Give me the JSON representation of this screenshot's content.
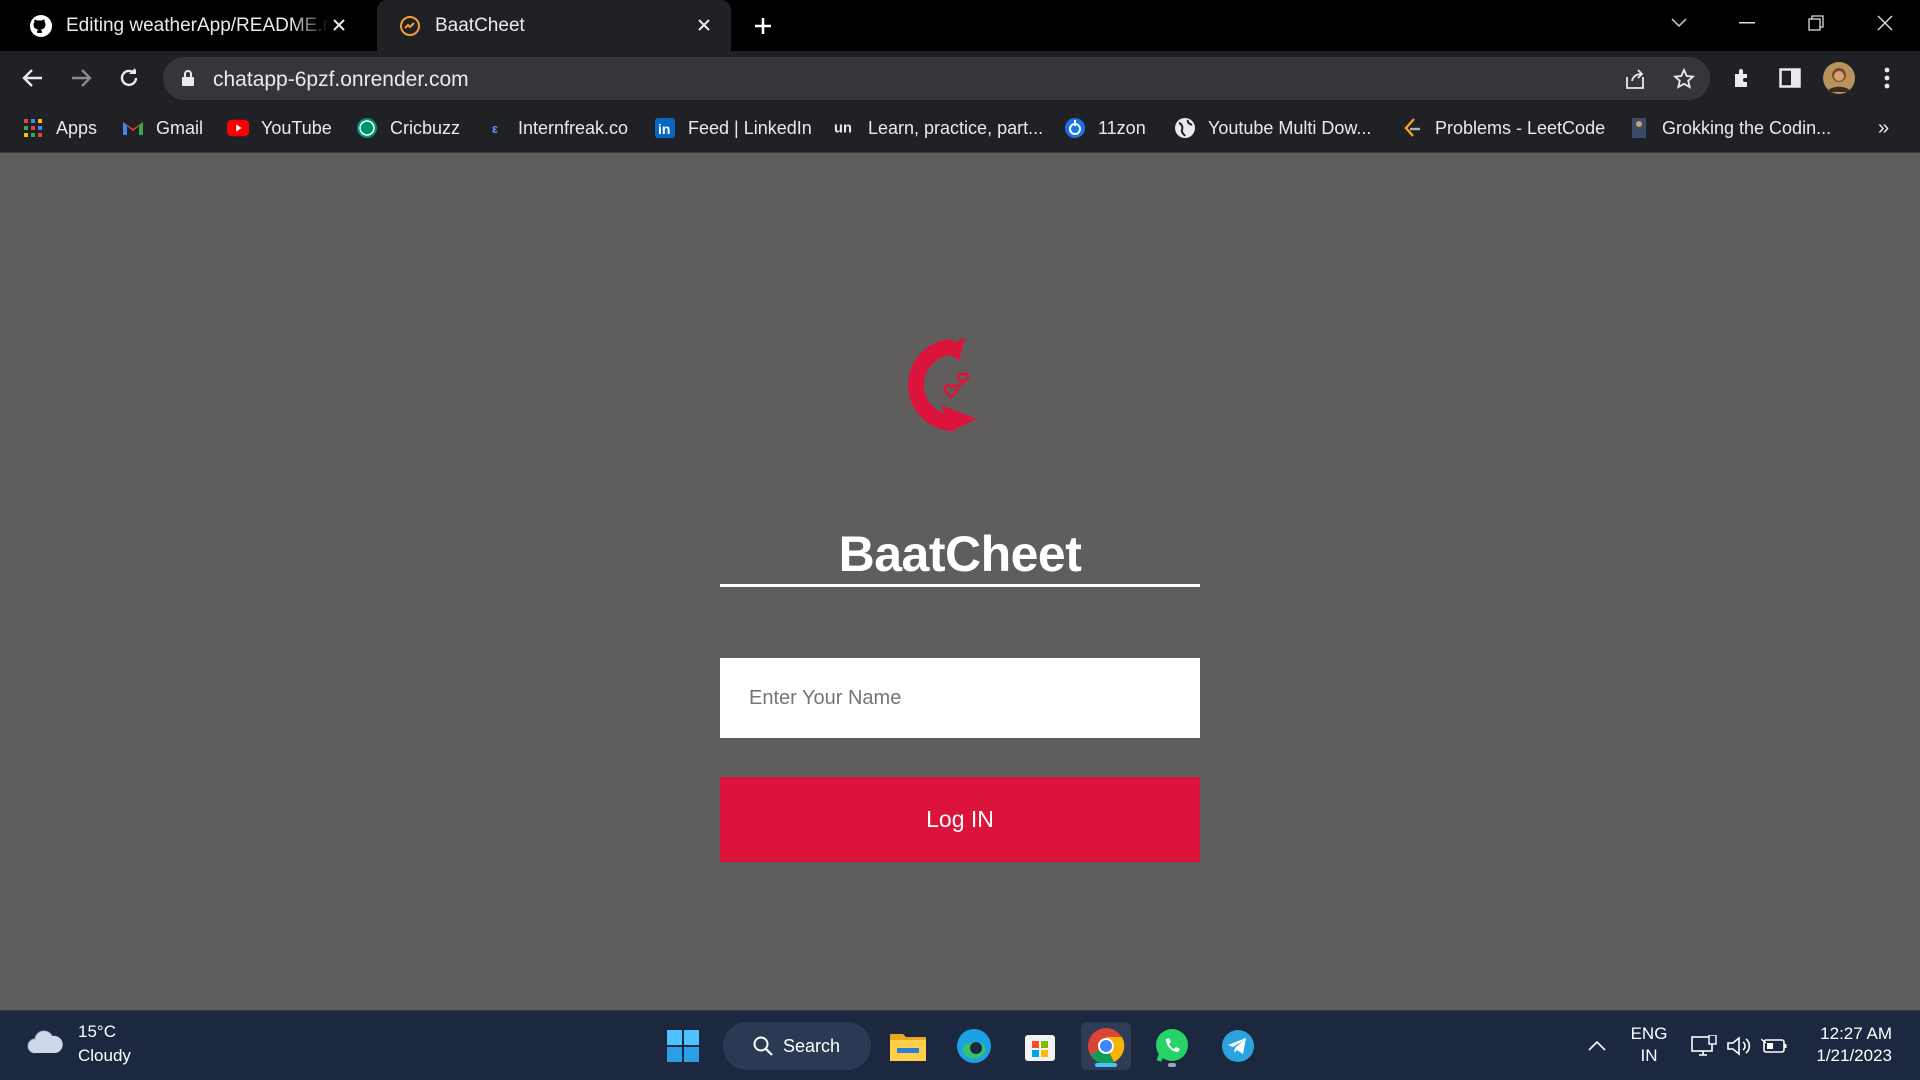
{
  "browser": {
    "tabs": [
      {
        "title": "Editing weatherApp/README.md",
        "icon": "github-icon",
        "active": false
      },
      {
        "title": "BaatCheet",
        "icon": "baatcheet-favicon",
        "active": true
      }
    ],
    "address": "chatapp-6pzf.onrender.com",
    "bookmarks": [
      {
        "label": "Apps",
        "icon": "apps-grid-icon"
      },
      {
        "label": "Gmail",
        "icon": "gmail-icon"
      },
      {
        "label": "YouTube",
        "icon": "youtube-icon"
      },
      {
        "label": "Cricbuzz",
        "icon": "cricbuzz-icon"
      },
      {
        "label": "Internfreak.co",
        "icon": "internfreak-icon"
      },
      {
        "label": "Feed | LinkedIn",
        "icon": "linkedin-icon"
      },
      {
        "label": "Learn, practice, part...",
        "icon": "unstop-icon"
      },
      {
        "label": "11zon",
        "icon": "11zon-icon"
      },
      {
        "label": "Youtube Multi Dow...",
        "icon": "globe-icon"
      },
      {
        "label": "Problems - LeetCode",
        "icon": "leetcode-icon"
      },
      {
        "label": "Grokking the Codin...",
        "icon": "grokking-icon"
      }
    ],
    "more_bookmarks": "»"
  },
  "app": {
    "title": "BaatCheet",
    "name_placeholder": "Enter Your Name",
    "login_label": "Log IN",
    "accent_color": "#dc143c"
  },
  "taskbar": {
    "weather_temp": "15°C",
    "weather_desc": "Cloudy",
    "search_label": "Search",
    "lang_line1": "ENG",
    "lang_line2": "IN",
    "time": "12:27 AM",
    "date": "1/21/2023"
  }
}
